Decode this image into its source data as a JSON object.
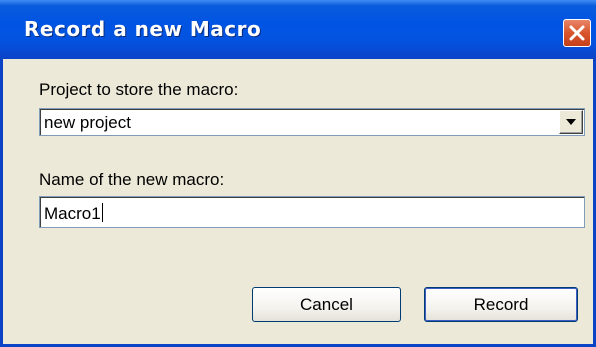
{
  "window": {
    "title": "Record a new Macro",
    "close_icon": "close-icon"
  },
  "project": {
    "label": "Project to store the macro:",
    "selected_value": "new project",
    "dropdown_icon": "chevron-down-icon"
  },
  "macro_name": {
    "label": "Name of the new macro:",
    "value": "Macro1"
  },
  "buttons": {
    "cancel_label": "Cancel",
    "record_label": "Record"
  },
  "colors": {
    "titlebar": "#0054e3",
    "close_button": "#d8552c",
    "dialog_background": "#ece9d8"
  }
}
